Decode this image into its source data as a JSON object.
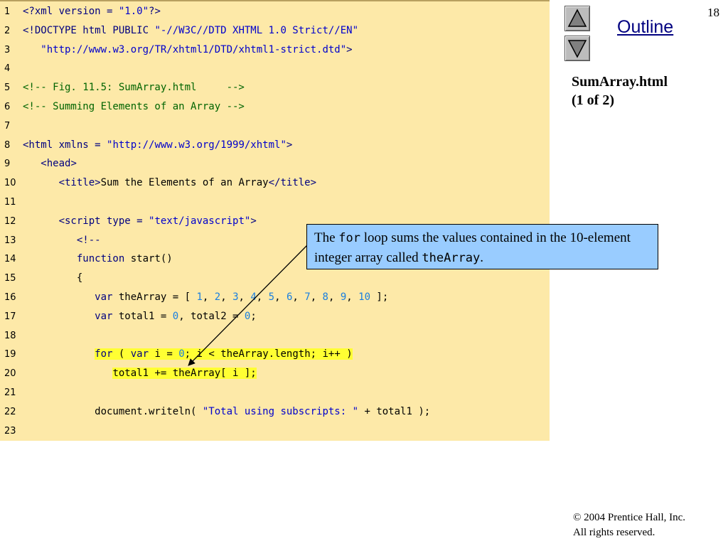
{
  "slide": {
    "number": "18",
    "outline_label": "Outline",
    "file_title_line1": "SumArray.html",
    "file_title_line2": "(1 of 2)",
    "copyright_symbol": "©",
    "copyright_line1": " 2004 Prentice Hall, Inc.",
    "copyright_line2": "All rights reserved.",
    "nav": {
      "up": "triangle-up-icon",
      "down": "triangle-down-icon"
    }
  },
  "callout": {
    "text_1": "The ",
    "code_1": "for",
    "text_2": " loop sums the values contained in the 10-element integer array called ",
    "code_2": "theArray",
    "text_3": "."
  },
  "colors": {
    "panel_bg": "#fde9a8",
    "highlight": "#ffff33",
    "callout_bg": "#99ccff",
    "keyword": "#000080",
    "string": "#0000cc",
    "number": "#1a7fe0",
    "comment": "#006400"
  },
  "code": {
    "lines": [
      {
        "n": "1",
        "segs": [
          [
            "kw",
            "<?xml version = "
          ],
          [
            "st",
            "\"1.0\""
          ],
          [
            "kw",
            "?>"
          ]
        ]
      },
      {
        "n": "2",
        "segs": [
          [
            "kw",
            "<!DOCTYPE html PUBLIC "
          ],
          [
            "st",
            "\"-//W3C//DTD XHTML 1.0 Strict//EN\""
          ]
        ]
      },
      {
        "n": "3",
        "segs": [
          [
            "tx",
            "   "
          ],
          [
            "st",
            "\"http://www.w3.org/TR/xhtml1/DTD/xhtml1-strict.dtd\""
          ],
          [
            "kw",
            ">"
          ]
        ]
      },
      {
        "n": "4",
        "segs": []
      },
      {
        "n": "5",
        "segs": [
          [
            "cm",
            "<!-- Fig. 11.5: SumArray.html     -->"
          ]
        ]
      },
      {
        "n": "6",
        "segs": [
          [
            "cm",
            "<!-- Summing Elements of an Array -->"
          ]
        ]
      },
      {
        "n": "7",
        "segs": []
      },
      {
        "n": "8",
        "segs": [
          [
            "kw",
            "<html xmlns = "
          ],
          [
            "st",
            "\"http://www.w3.org/1999/xhtml\""
          ],
          [
            "kw",
            ">"
          ]
        ]
      },
      {
        "n": "9",
        "segs": [
          [
            "tx",
            "   "
          ],
          [
            "kw",
            "<head>"
          ]
        ]
      },
      {
        "n": "10",
        "segs": [
          [
            "tx",
            "      "
          ],
          [
            "kw",
            "<title>"
          ],
          [
            "tx",
            "Sum the Elements of an Array"
          ],
          [
            "kw",
            "</title>"
          ]
        ]
      },
      {
        "n": "11",
        "segs": []
      },
      {
        "n": "12",
        "segs": [
          [
            "tx",
            "      "
          ],
          [
            "kw",
            "<script type = "
          ],
          [
            "st",
            "\"text/javascript\""
          ],
          [
            "kw",
            ">"
          ]
        ]
      },
      {
        "n": "13",
        "segs": [
          [
            "tx",
            "         "
          ],
          [
            "kw",
            "<!--"
          ]
        ]
      },
      {
        "n": "14",
        "segs": [
          [
            "tx",
            "         "
          ],
          [
            "kw",
            "function"
          ],
          [
            "tx",
            " start()"
          ]
        ]
      },
      {
        "n": "15",
        "segs": [
          [
            "tx",
            "         {"
          ]
        ]
      },
      {
        "n": "16",
        "segs": [
          [
            "tx",
            "            "
          ],
          [
            "kw",
            "var"
          ],
          [
            "tx",
            " theArray = [ "
          ],
          [
            "nm",
            "1"
          ],
          [
            "tx",
            ", "
          ],
          [
            "nm",
            "2"
          ],
          [
            "tx",
            ", "
          ],
          [
            "nm",
            "3"
          ],
          [
            "tx",
            ", "
          ],
          [
            "nm",
            "4"
          ],
          [
            "tx",
            ", "
          ],
          [
            "nm",
            "5"
          ],
          [
            "tx",
            ", "
          ],
          [
            "nm",
            "6"
          ],
          [
            "tx",
            ", "
          ],
          [
            "nm",
            "7"
          ],
          [
            "tx",
            ", "
          ],
          [
            "nm",
            "8"
          ],
          [
            "tx",
            ", "
          ],
          [
            "nm",
            "9"
          ],
          [
            "tx",
            ", "
          ],
          [
            "nm",
            "10"
          ],
          [
            "tx",
            " ];"
          ]
        ]
      },
      {
        "n": "17",
        "segs": [
          [
            "tx",
            "            "
          ],
          [
            "kw",
            "var"
          ],
          [
            "tx",
            " total1 = "
          ],
          [
            "nm",
            "0"
          ],
          [
            "tx",
            ", total2 = "
          ],
          [
            "nm",
            "0"
          ],
          [
            "tx",
            ";"
          ]
        ]
      },
      {
        "n": "18",
        "segs": []
      },
      {
        "n": "19",
        "segs": [
          [
            "tx",
            "            "
          ],
          [
            "kwh",
            "for"
          ],
          [
            "txh",
            " ( "
          ],
          [
            "kwh",
            "var"
          ],
          [
            "txh",
            " i = "
          ],
          [
            "nmh",
            "0"
          ],
          [
            "txh",
            "; i < theArray.length; i++ )"
          ]
        ]
      },
      {
        "n": "20",
        "segs": [
          [
            "tx",
            "               "
          ],
          [
            "txh",
            "total1 += theArray[ i ];"
          ]
        ]
      },
      {
        "n": "21",
        "segs": []
      },
      {
        "n": "22",
        "segs": [
          [
            "tx",
            "            document.writeln( "
          ],
          [
            "st",
            "\"Total using subscripts: \""
          ],
          [
            "tx",
            " + total1 );"
          ]
        ]
      },
      {
        "n": "23",
        "segs": []
      }
    ]
  }
}
